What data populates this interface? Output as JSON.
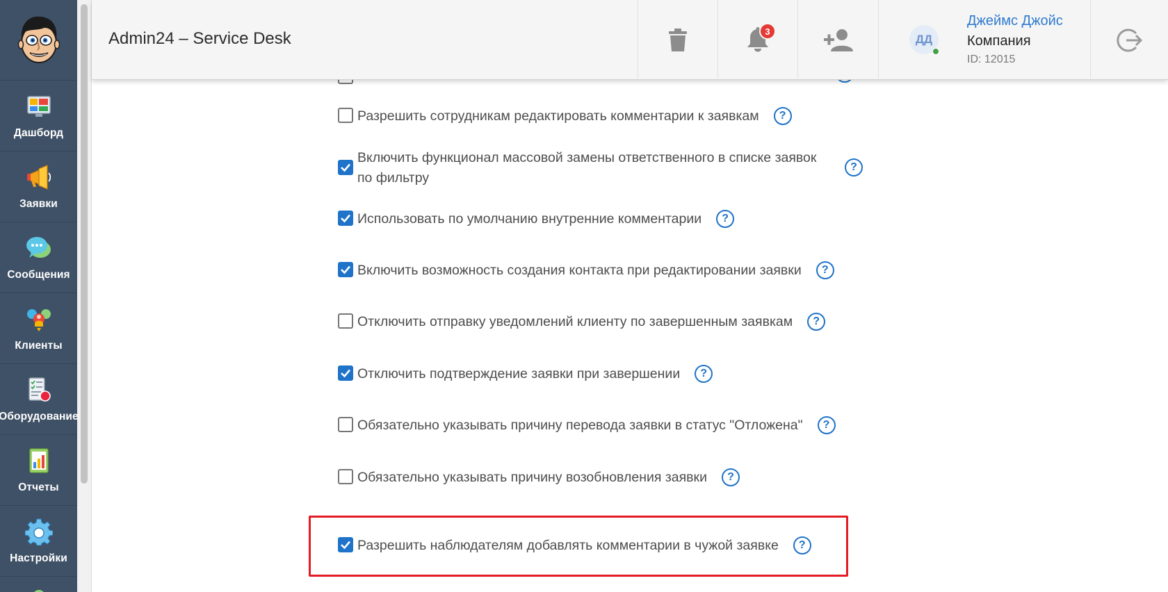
{
  "colors": {
    "sidebar": "#3f5166",
    "accent": "#1f73c8",
    "highlight": "#e31b23",
    "badge": "#e53935",
    "online": "#43a047"
  },
  "sidebar": {
    "logo": "avatar-face-logo",
    "items": [
      {
        "label": "Дашборд",
        "icon": "dashboard-icon"
      },
      {
        "label": "Заявки",
        "icon": "megaphone-icon"
      },
      {
        "label": "Сообщения",
        "icon": "chat-bubbles-icon"
      },
      {
        "label": "Клиенты",
        "icon": "clients-icon"
      },
      {
        "label": "Оборудование",
        "icon": "equipment-icon"
      },
      {
        "label": "Отчеты",
        "icon": "reports-icon"
      },
      {
        "label": "Настройки",
        "icon": "gear-icon"
      }
    ]
  },
  "header": {
    "title": "Admin24 – Service Desk",
    "notifications_count": "3",
    "user": {
      "initials": "ДД",
      "name": "Джеймс Джойс",
      "company": "Компания",
      "id": "ID: 12015"
    }
  },
  "settings": {
    "help_glyph": "?",
    "options": [
      {
        "label": "Разрешить сотрудникам редактировать комментарии к заявкам",
        "checked": false
      },
      {
        "label": "Включить функционал массовой замены ответственного в списке заявок по фильтру",
        "checked": true
      },
      {
        "label": "Использовать по умолчанию внутренние комментарии",
        "checked": true
      },
      {
        "label": "Включить возможность создания контакта при редактировании заявки",
        "checked": true
      },
      {
        "label": "Отключить отправку уведомлений клиенту по завершенным заявкам",
        "checked": false
      },
      {
        "label": "Отключить подтверждение заявки при завершении",
        "checked": true
      },
      {
        "label": "Обязательно указывать причину перевода заявки в статус \"Отложена\"",
        "checked": false
      },
      {
        "label": "Обязательно указывать причину возобновления заявки",
        "checked": false
      },
      {
        "label": "Разрешить наблюдателям добавлять комментарии в чужой заявке",
        "checked": true
      }
    ]
  }
}
